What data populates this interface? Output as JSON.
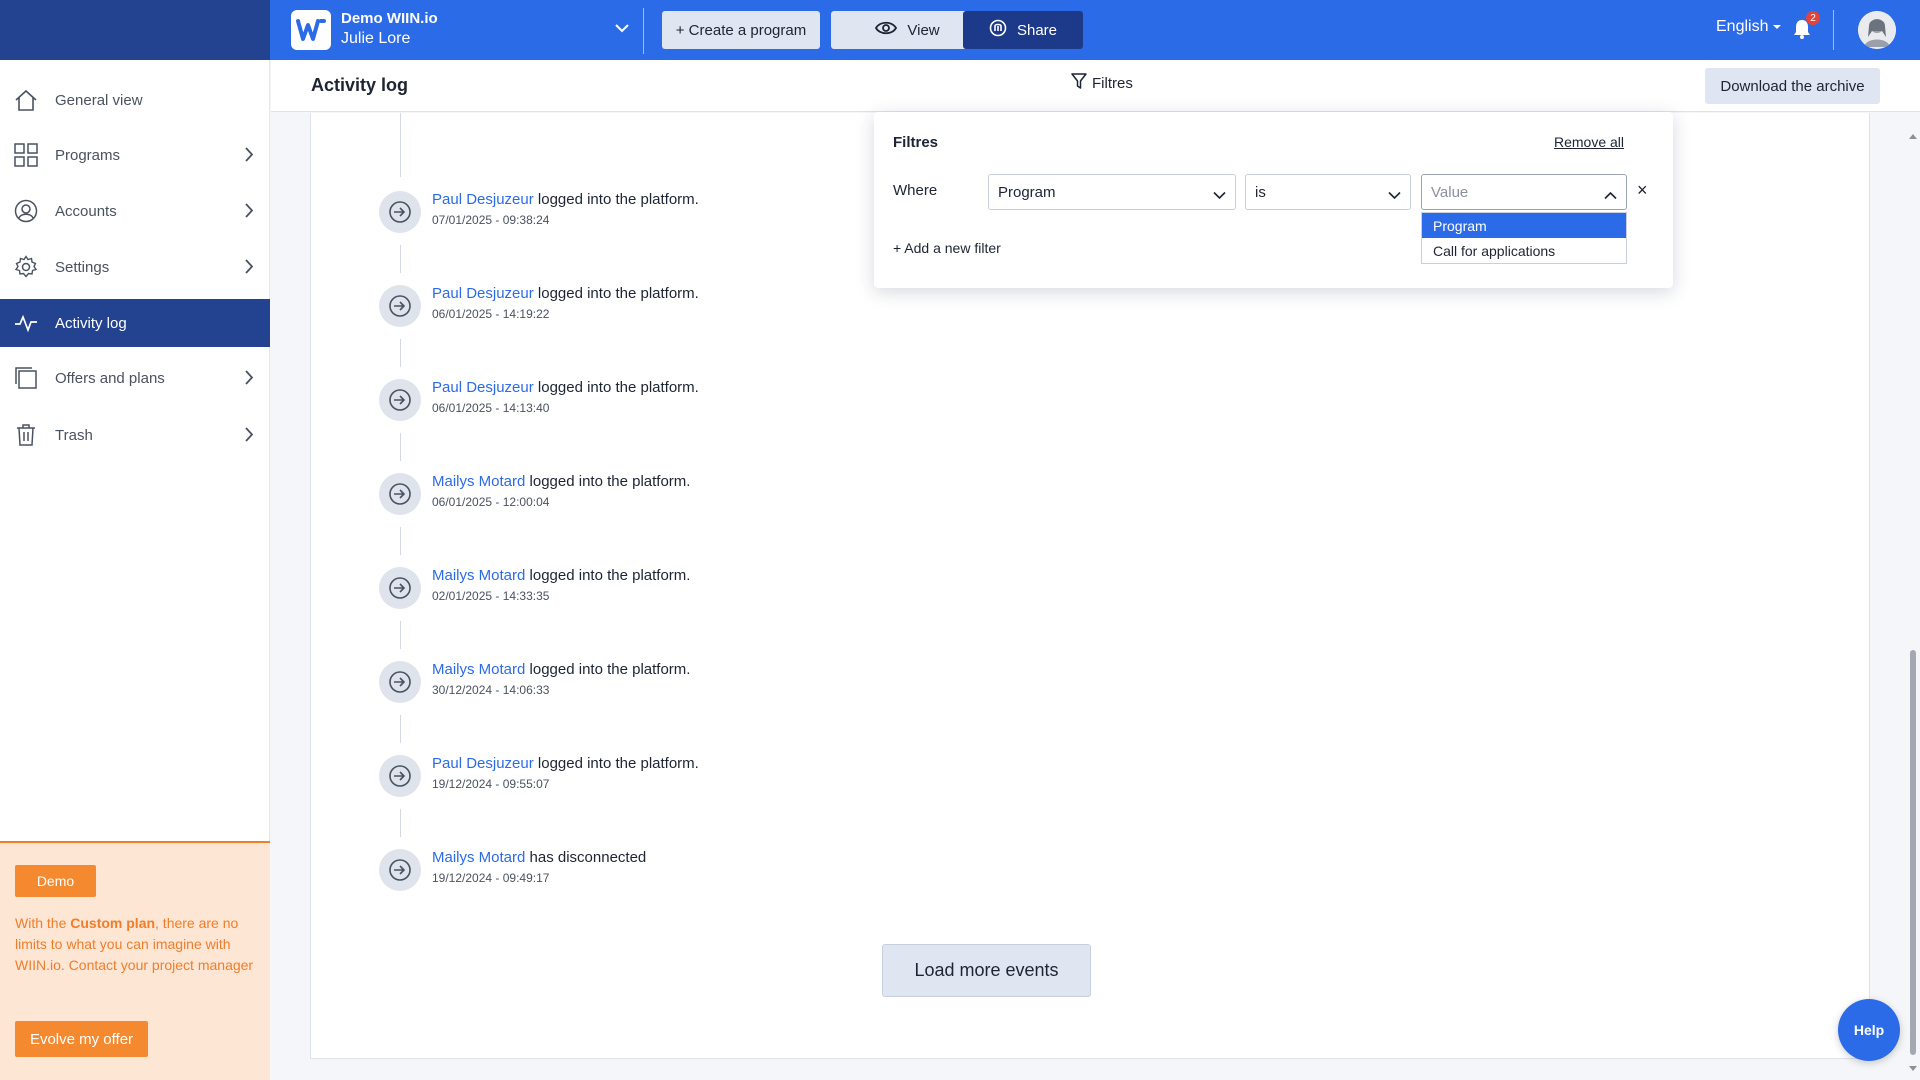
{
  "header": {
    "org_name": "Demo WIIN.io",
    "user_name": "Julie Lore",
    "create_label": "+ Create a program",
    "view_label": "View",
    "share_label": "Share",
    "language": "English",
    "notification_count": "2",
    "brand_color": "#2c6be8",
    "brand_dark": "#23428f"
  },
  "sidebar": {
    "items": [
      {
        "label": "General view",
        "icon": "home-icon"
      },
      {
        "label": "Programs",
        "icon": "grid-icon"
      },
      {
        "label": "Accounts",
        "icon": "user-circle-icon"
      },
      {
        "label": "Settings",
        "icon": "gear-icon"
      },
      {
        "label": "Activity log",
        "icon": "activity-icon",
        "active": true
      },
      {
        "label": "Offers and plans",
        "icon": "copy-icon"
      },
      {
        "label": "Trash",
        "icon": "trash-icon"
      }
    ],
    "promo": {
      "badge": "Demo",
      "text_before": "With the ",
      "text_bold": "Custom plan",
      "text_after": ", there are no limits to what you can imagine with WIIN.io. Contact your project manager",
      "button": "Evolve my offer",
      "accent": "#f5892f"
    }
  },
  "page": {
    "title": "Activity log",
    "filters_label": "Filtres",
    "download_label": "Download the archive",
    "load_more": "Load more events"
  },
  "events": [
    {
      "user": "Paul Desjuzeur",
      "action": "logged into the platform.",
      "date": "07/01/2025 - 09:38:24"
    },
    {
      "user": "Paul Desjuzeur",
      "action": "logged into the platform.",
      "date": "06/01/2025 - 14:19:22"
    },
    {
      "user": "Paul Desjuzeur",
      "action": "logged into the platform.",
      "date": "06/01/2025 - 14:13:40"
    },
    {
      "user": "Mailys Motard",
      "action": "logged into the platform.",
      "date": "06/01/2025 - 12:00:04"
    },
    {
      "user": "Mailys Motard",
      "action": "logged into the platform.",
      "date": "02/01/2025 - 14:33:35"
    },
    {
      "user": "Mailys Motard",
      "action": "logged into the platform.",
      "date": "30/12/2024 - 14:06:33"
    },
    {
      "user": "Paul Desjuzeur",
      "action": "logged into the platform.",
      "date": "19/12/2024 - 09:55:07"
    },
    {
      "user": "Mailys Motard",
      "action": "has disconnected",
      "date": "19/12/2024 - 09:49:17"
    }
  ],
  "filter_panel": {
    "title": "Filtres",
    "remove_all": "Remove all",
    "where": "Where",
    "field_value": "Program",
    "operator_value": "is",
    "value_placeholder": "Value",
    "close": "×",
    "add_filter": "+ Add a new filter",
    "options": [
      "Program",
      "Call for applications"
    ],
    "selected_option": "Program"
  },
  "help": {
    "label": "Help"
  }
}
